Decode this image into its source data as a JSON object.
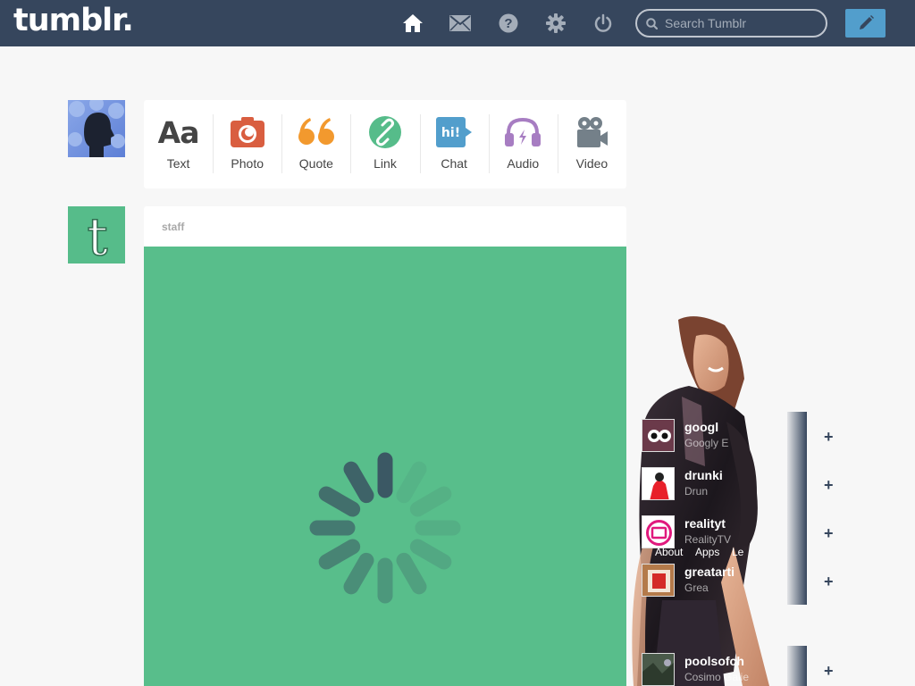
{
  "header": {
    "logo": "tumblr.",
    "search_placeholder": "Search Tumblr",
    "nav_icons": [
      "home-icon",
      "mail-icon",
      "help-icon",
      "gear-icon",
      "power-icon"
    ],
    "compose_icon": "pencil-icon"
  },
  "post_types": [
    {
      "label": "Text",
      "icon": "text-icon",
      "glyph": "Aa",
      "color": "#444444"
    },
    {
      "label": "Photo",
      "icon": "camera-icon",
      "color": "#d95e40"
    },
    {
      "label": "Quote",
      "icon": "quote-icon",
      "glyph": "“",
      "color": "#f2992e"
    },
    {
      "label": "Link",
      "icon": "link-icon",
      "color": "#56bc8a"
    },
    {
      "label": "Chat",
      "icon": "chat-icon",
      "glyph": "hi!",
      "color": "#529ecc"
    },
    {
      "label": "Audio",
      "icon": "headphones-icon",
      "color": "#a77dc2"
    },
    {
      "label": "Video",
      "icon": "video-camera-icon",
      "color": "#748089"
    }
  ],
  "post": {
    "blog_name": "staff",
    "staff_avatar_glyph": "t",
    "media_color": "#58be8b"
  },
  "sidebar": {
    "recommended": [
      {
        "name": "googl",
        "sub": "Googly E"
      },
      {
        "name": "drunki",
        "sub": "Drun"
      },
      {
        "name": "realityt",
        "sub": "RealityTV"
      },
      {
        "name": "greatarti",
        "sub": "Grea"
      },
      {
        "name": "poolsofch",
        "sub": "Cosimo Galie"
      }
    ],
    "footer_links": [
      "About",
      "Apps",
      "Le"
    ]
  },
  "colors": {
    "header": "#36465d",
    "compose": "#529ecc",
    "brand_green": "#56bc8a"
  }
}
